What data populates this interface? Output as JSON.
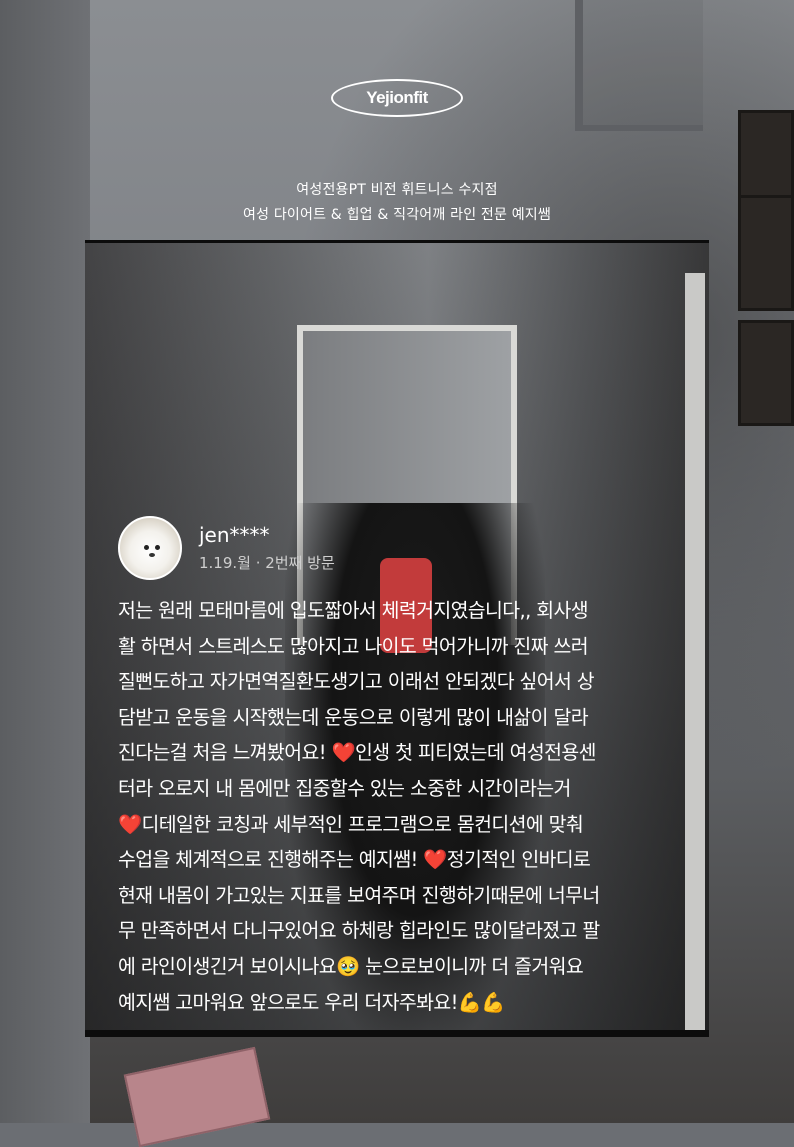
{
  "brand": {
    "logo_text": "Yejionfit"
  },
  "header": {
    "line1": "여성전용PT 비전 휘트니스 수지점",
    "line2": "여성 다이어트 & 힙업 & 직각어깨 라인 전문 예지쌤"
  },
  "review": {
    "username": "jen****",
    "visit_info": "1.19.월 · 2번째 방문",
    "lines": [
      "저는 원래 모태마름에 입도짧아서 체력거지였습니다,, 회사생",
      "활 하면서 스트레스도 많아지고 나이도 먹어가니까 진짜 쓰러",
      "질뻔도하고 자가면역질환도생기고 이래선 안되겠다 싶어서 상",
      "담받고 운동을 시작했는데 운동으로 이렇게 많이 내삶이 달라",
      "진다는걸 처음 느껴봤어요! ❤️인생 첫 피티였는데 여성전용센",
      "터라 오로지 내 몸에만 집중할수 있는 소중한 시간이라는거",
      "❤️디테일한 코칭과 세부적인 프로그램으로 몸컨디션에 맞춰",
      "수업을 체계적으로 진행해주는 예지쌤! ❤️정기적인 인바디로",
      "현재 내몸이 가고있는 지표를 보여주며 진행하기때문에 너무너",
      "무 만족하면서 다니구있어요 하체랑 힙라인도 많이달라졌고 팔",
      "에 라인이생긴거 보이시나요🥹 눈으로보이니까 더 즐거워요",
      "예지쌤 고마워요 앞으로도 우리 더자주봐요!💪💪"
    ]
  },
  "colors": {
    "text": "#ffffff",
    "muted_text": "#cfcfcf",
    "heart": "#e0212b",
    "card_border": "#0c0c0c"
  }
}
